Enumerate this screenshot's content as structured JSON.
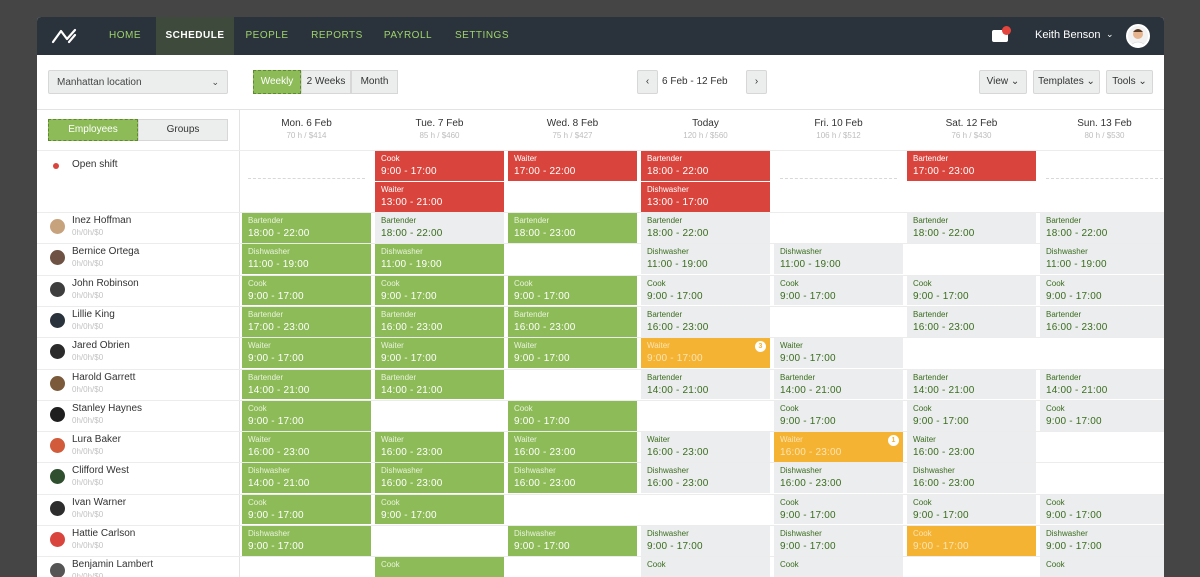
{
  "nav": {
    "items": [
      "HOME",
      "SCHEDULE",
      "PEOPLE",
      "REPORTS",
      "PAYROLL",
      "SETTINGS"
    ],
    "active": "SCHEDULE",
    "user_name": "Keith Benson"
  },
  "toolbar": {
    "location": "Manhattan location",
    "views": [
      "Weekly",
      "2 Weeks",
      "Month"
    ],
    "active_view": "Weekly",
    "date_range": "6 Feb - 12 Feb",
    "view_btn": "View",
    "templates_btn": "Templates",
    "tools_btn": "Tools"
  },
  "panel": {
    "toggle": [
      "Employees",
      "Groups"
    ],
    "open_shift_label": "Open shift"
  },
  "days": [
    {
      "name": "Mon. 6 Feb",
      "sub": "70 h / $414"
    },
    {
      "name": "Tue. 7 Feb",
      "sub": "85 h / $460"
    },
    {
      "name": "Wed. 8 Feb",
      "sub": "75 h / $427"
    },
    {
      "name": "Today",
      "sub": "120 h / $560"
    },
    {
      "name": "Fri. 10 Feb",
      "sub": "106 h / $512"
    },
    {
      "name": "Sat. 12 Feb",
      "sub": "76 h / $430"
    },
    {
      "name": "Sun. 13 Feb",
      "sub": "80 h / $530"
    }
  ],
  "employees": [
    {
      "name": "Inez Hoffman",
      "sub": "0h/0h/$0",
      "color": "#c7a37d"
    },
    {
      "name": "Bernice Ortega",
      "sub": "0h/0h/$0",
      "color": "#6e5243"
    },
    {
      "name": "John Robinson",
      "sub": "0h/0h/$0",
      "color": "#3e3e3e"
    },
    {
      "name": "Lillie King",
      "sub": "0h/0h/$0",
      "color": "#2a323b"
    },
    {
      "name": "Jared Obrien",
      "sub": "0h/0h/$0",
      "color": "#2b2b2b"
    },
    {
      "name": "Harold Garrett",
      "sub": "0h/0h/$0",
      "color": "#7a5a3a"
    },
    {
      "name": "Stanley Haynes",
      "sub": "0h/0h/$0",
      "color": "#1f1f1f"
    },
    {
      "name": "Lura Baker",
      "sub": "0h/0h/$0",
      "color": "#d15b3b"
    },
    {
      "name": "Clifford West",
      "sub": "0h/0h/$0",
      "color": "#2f4f2f"
    },
    {
      "name": "Ivan Warner",
      "sub": "0h/0h/$0",
      "color": "#2d2d2d"
    },
    {
      "name": "Hattie Carlson",
      "sub": "0h/0h/$0",
      "color": "#d9453d"
    },
    {
      "name": "Benjamin Lambert",
      "sub": "0h/0h/$0",
      "color": "#555555"
    }
  ],
  "open_shifts": [
    {
      "day": 1,
      "slot": 0,
      "role": "Cook",
      "time": "9:00 - 17:00"
    },
    {
      "day": 1,
      "slot": 1,
      "role": "Waiter",
      "time": "13:00 - 21:00"
    },
    {
      "day": 2,
      "slot": 0,
      "role": "Waiter",
      "time": "17:00 - 22:00"
    },
    {
      "day": 3,
      "slot": 0,
      "role": "Bartender",
      "time": "18:00 - 22:00"
    },
    {
      "day": 3,
      "slot": 1,
      "role": "Dishwasher",
      "time": "13:00 - 17:00"
    },
    {
      "day": 5,
      "slot": 0,
      "role": "Bartender",
      "time": "17:00 - 23:00"
    }
  ],
  "shifts": [
    {
      "row": 0,
      "day": 0,
      "kind": "green",
      "role": "Bartender",
      "time": "18:00 - 22:00"
    },
    {
      "row": 1,
      "day": 0,
      "kind": "green",
      "role": "Dishwasher",
      "time": "11:00 - 19:00"
    },
    {
      "row": 2,
      "day": 0,
      "kind": "green",
      "role": "Cook",
      "time": "9:00 - 17:00"
    },
    {
      "row": 3,
      "day": 0,
      "kind": "green",
      "role": "Bartender",
      "time": "17:00 - 23:00"
    },
    {
      "row": 4,
      "day": 0,
      "kind": "green",
      "role": "Waiter",
      "time": "9:00 - 17:00"
    },
    {
      "row": 5,
      "day": 0,
      "kind": "green",
      "role": "Bartender",
      "time": "14:00 - 21:00"
    },
    {
      "row": 6,
      "day": 0,
      "kind": "green",
      "role": "Cook",
      "time": "9:00 - 17:00"
    },
    {
      "row": 7,
      "day": 0,
      "kind": "green",
      "role": "Waiter",
      "time": "16:00 - 23:00"
    },
    {
      "row": 8,
      "day": 0,
      "kind": "green",
      "role": "Dishwasher",
      "time": "14:00 - 21:00"
    },
    {
      "row": 9,
      "day": 0,
      "kind": "green",
      "role": "Cook",
      "time": "9:00 - 17:00"
    },
    {
      "row": 10,
      "day": 0,
      "kind": "green",
      "role": "Dishwasher",
      "time": "9:00 - 17:00"
    },
    {
      "row": 0,
      "day": 1,
      "kind": "gray",
      "role": "Bartender",
      "time": "18:00 - 22:00"
    },
    {
      "row": 1,
      "day": 1,
      "kind": "green",
      "role": "Dishwasher",
      "time": "11:00 - 19:00"
    },
    {
      "row": 2,
      "day": 1,
      "kind": "green",
      "role": "Cook",
      "time": "9:00 - 17:00"
    },
    {
      "row": 3,
      "day": 1,
      "kind": "green",
      "role": "Bartender",
      "time": "16:00 - 23:00"
    },
    {
      "row": 4,
      "day": 1,
      "kind": "green",
      "role": "Waiter",
      "time": "9:00 - 17:00"
    },
    {
      "row": 5,
      "day": 1,
      "kind": "green",
      "role": "Bartender",
      "time": "14:00 - 21:00"
    },
    {
      "row": 7,
      "day": 1,
      "kind": "green",
      "role": "Waiter",
      "time": "16:00 - 23:00"
    },
    {
      "row": 8,
      "day": 1,
      "kind": "green",
      "role": "Dishwasher",
      "time": "16:00 - 23:00"
    },
    {
      "row": 9,
      "day": 1,
      "kind": "green",
      "role": "Cook",
      "time": "9:00 - 17:00"
    },
    {
      "row": 11,
      "day": 1,
      "kind": "green",
      "role": "Cook",
      "time": ""
    },
    {
      "row": 0,
      "day": 2,
      "kind": "green",
      "role": "Bartender",
      "time": "18:00 - 23:00"
    },
    {
      "row": 2,
      "day": 2,
      "kind": "green",
      "role": "Cook",
      "time": "9:00 - 17:00"
    },
    {
      "row": 3,
      "day": 2,
      "kind": "green",
      "role": "Bartender",
      "time": "16:00 - 23:00"
    },
    {
      "row": 4,
      "day": 2,
      "kind": "green",
      "role": "Waiter",
      "time": "9:00 - 17:00"
    },
    {
      "row": 6,
      "day": 2,
      "kind": "green",
      "role": "Cook",
      "time": "9:00 - 17:00"
    },
    {
      "row": 7,
      "day": 2,
      "kind": "green",
      "role": "Waiter",
      "time": "16:00 - 23:00"
    },
    {
      "row": 8,
      "day": 2,
      "kind": "green",
      "role": "Dishwasher",
      "time": "16:00 - 23:00"
    },
    {
      "row": 10,
      "day": 2,
      "kind": "green",
      "role": "Dishwasher",
      "time": "9:00 - 17:00"
    },
    {
      "row": 0,
      "day": 3,
      "kind": "gray",
      "role": "Bartender",
      "time": "18:00 - 22:00"
    },
    {
      "row": 1,
      "day": 3,
      "kind": "gray",
      "role": "Dishwasher",
      "time": "11:00 - 19:00"
    },
    {
      "row": 2,
      "day": 3,
      "kind": "gray",
      "role": "Cook",
      "time": "9:00 - 17:00"
    },
    {
      "row": 3,
      "day": 3,
      "kind": "gray",
      "role": "Bartender",
      "time": "16:00 - 23:00"
    },
    {
      "row": 4,
      "day": 3,
      "kind": "orange",
      "role": "Waiter",
      "time": "9:00 - 17:00",
      "badge": "3"
    },
    {
      "row": 5,
      "day": 3,
      "kind": "gray",
      "role": "Bartender",
      "time": "14:00 - 21:00"
    },
    {
      "row": 7,
      "day": 3,
      "kind": "gray",
      "role": "Waiter",
      "time": "16:00 - 23:00"
    },
    {
      "row": 8,
      "day": 3,
      "kind": "gray",
      "role": "Dishwasher",
      "time": "16:00 - 23:00"
    },
    {
      "row": 10,
      "day": 3,
      "kind": "gray",
      "role": "Dishwasher",
      "time": "9:00 - 17:00"
    },
    {
      "row": 11,
      "day": 3,
      "kind": "gray",
      "role": "Cook",
      "time": ""
    },
    {
      "row": 1,
      "day": 4,
      "kind": "gray",
      "role": "Dishwasher",
      "time": "11:00 - 19:00"
    },
    {
      "row": 2,
      "day": 4,
      "kind": "gray",
      "role": "Cook",
      "time": "9:00 - 17:00"
    },
    {
      "row": 4,
      "day": 4,
      "kind": "gray",
      "role": "Waiter",
      "time": "9:00 - 17:00"
    },
    {
      "row": 5,
      "day": 4,
      "kind": "gray",
      "role": "Bartender",
      "time": "14:00 - 21:00"
    },
    {
      "row": 6,
      "day": 4,
      "kind": "gray",
      "role": "Cook",
      "time": "9:00 - 17:00"
    },
    {
      "row": 7,
      "day": 4,
      "kind": "orange",
      "role": "Waiter",
      "time": "16:00 - 23:00",
      "badge": "1"
    },
    {
      "row": 8,
      "day": 4,
      "kind": "gray",
      "role": "Dishwasher",
      "time": "16:00 - 23:00"
    },
    {
      "row": 9,
      "day": 4,
      "kind": "gray",
      "role": "Cook",
      "time": "9:00 - 17:00"
    },
    {
      "row": 10,
      "day": 4,
      "kind": "gray",
      "role": "Dishwasher",
      "time": "9:00 - 17:00"
    },
    {
      "row": 11,
      "day": 4,
      "kind": "gray",
      "role": "Cook",
      "time": ""
    },
    {
      "row": 0,
      "day": 5,
      "kind": "gray",
      "role": "Bartender",
      "time": "18:00 - 22:00"
    },
    {
      "row": 2,
      "day": 5,
      "kind": "gray",
      "role": "Cook",
      "time": "9:00 - 17:00"
    },
    {
      "row": 3,
      "day": 5,
      "kind": "gray",
      "role": "Bartender",
      "time": "16:00 - 23:00"
    },
    {
      "row": 5,
      "day": 5,
      "kind": "gray",
      "role": "Bartender",
      "time": "14:00 - 21:00"
    },
    {
      "row": 6,
      "day": 5,
      "kind": "gray",
      "role": "Cook",
      "time": "9:00 - 17:00"
    },
    {
      "row": 7,
      "day": 5,
      "kind": "gray",
      "role": "Waiter",
      "time": "16:00 - 23:00"
    },
    {
      "row": 8,
      "day": 5,
      "kind": "gray",
      "role": "Dishwasher",
      "time": "16:00 - 23:00"
    },
    {
      "row": 9,
      "day": 5,
      "kind": "gray",
      "role": "Cook",
      "time": "9:00 - 17:00"
    },
    {
      "row": 10,
      "day": 5,
      "kind": "orange",
      "role": "Cook",
      "time": "9:00 - 17:00"
    },
    {
      "row": 0,
      "day": 6,
      "kind": "gray",
      "role": "Bartender",
      "time": "18:00 - 22:00"
    },
    {
      "row": 1,
      "day": 6,
      "kind": "gray",
      "role": "Dishwasher",
      "time": "11:00 - 19:00"
    },
    {
      "row": 2,
      "day": 6,
      "kind": "gray",
      "role": "Cook",
      "time": "9:00 - 17:00"
    },
    {
      "row": 3,
      "day": 6,
      "kind": "gray",
      "role": "Bartender",
      "time": "16:00 - 23:00"
    },
    {
      "row": 5,
      "day": 6,
      "kind": "gray",
      "role": "Bartender",
      "time": "14:00 - 21:00"
    },
    {
      "row": 6,
      "day": 6,
      "kind": "gray",
      "role": "Cook",
      "time": "9:00 - 17:00"
    },
    {
      "row": 9,
      "day": 6,
      "kind": "gray",
      "role": "Cook",
      "time": "9:00 - 17:00"
    },
    {
      "row": 10,
      "day": 6,
      "kind": "gray",
      "role": "Dishwasher",
      "time": "9:00 - 17:00"
    },
    {
      "row": 11,
      "day": 6,
      "kind": "gray",
      "role": "Cook",
      "time": ""
    }
  ]
}
